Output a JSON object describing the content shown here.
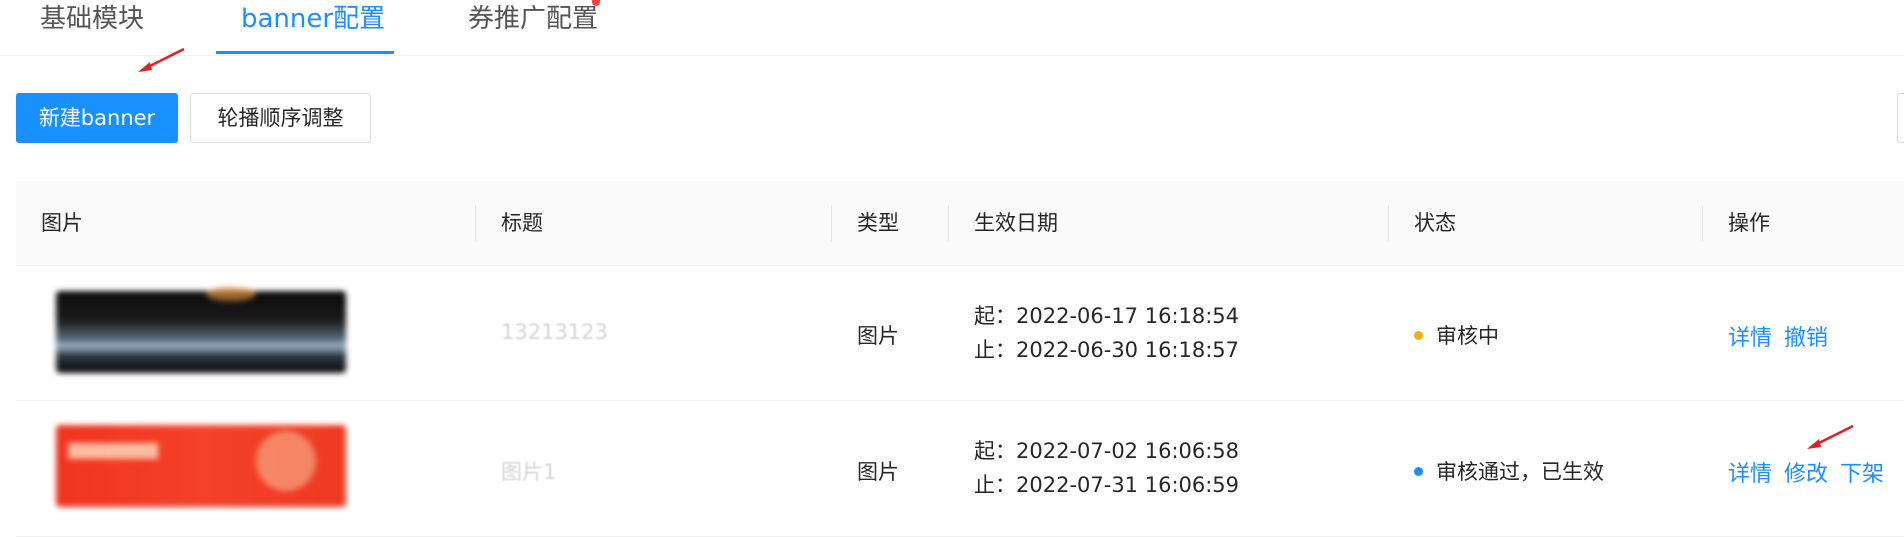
{
  "tabs": [
    {
      "label": "基础模块",
      "active": false
    },
    {
      "label": "banner配置",
      "active": true
    },
    {
      "label": "券推广配置",
      "active": false
    }
  ],
  "toolbar": {
    "new_banner_label": "新建banner",
    "reorder_label": "轮播顺序调整"
  },
  "table": {
    "columns": [
      "图片",
      "标题",
      "类型",
      "生效日期",
      "状态",
      "操作"
    ],
    "rows": [
      {
        "title": "13213123",
        "type": "图片",
        "start": "起：2022-06-17 16:18:54",
        "end": "止：2022-06-30 16:18:57",
        "status": "审核中",
        "status_color": "#faad14",
        "actions": [
          "详情",
          "撤销"
        ]
      },
      {
        "title": "图片1",
        "type": "图片",
        "start": "起：2022-07-02 16:06:58",
        "end": "止：2022-07-31 16:06:59",
        "status": "审核通过，已生效",
        "status_color": "#1890ff",
        "actions": [
          "详情",
          "修改",
          "下架"
        ]
      }
    ]
  },
  "colors": {
    "accent": "#1890ff",
    "annotation": "#e02020"
  }
}
